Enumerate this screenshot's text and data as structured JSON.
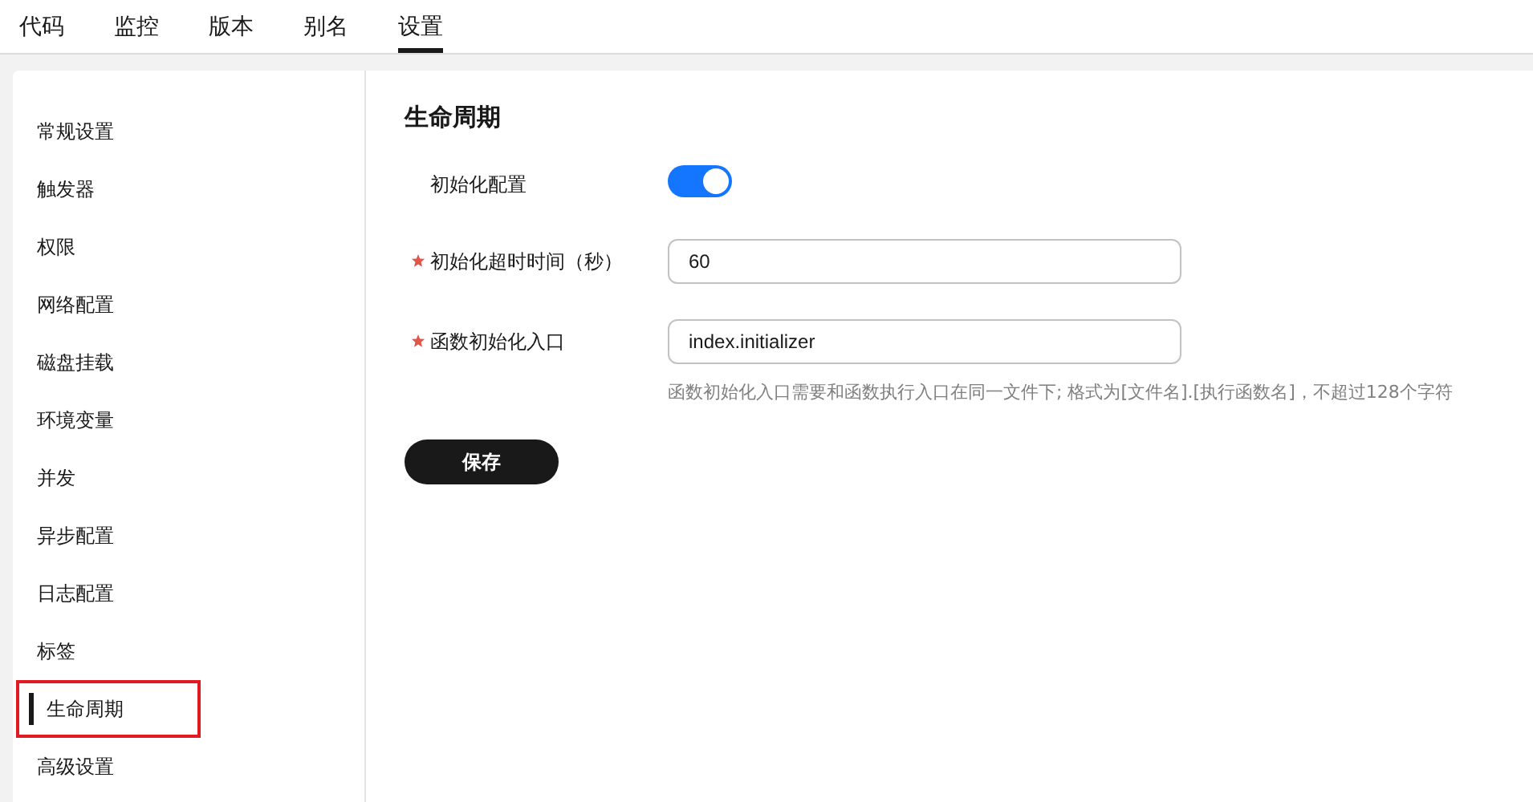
{
  "tabs": [
    {
      "label": "代码",
      "selected": false
    },
    {
      "label": "监控",
      "selected": false
    },
    {
      "label": "版本",
      "selected": false
    },
    {
      "label": "别名",
      "selected": false
    },
    {
      "label": "设置",
      "selected": true
    }
  ],
  "sidebar": {
    "items": [
      {
        "label": "常规设置",
        "selected": false,
        "highlighted": false
      },
      {
        "label": "触发器",
        "selected": false,
        "highlighted": false
      },
      {
        "label": "权限",
        "selected": false,
        "highlighted": false
      },
      {
        "label": "网络配置",
        "selected": false,
        "highlighted": false
      },
      {
        "label": "磁盘挂载",
        "selected": false,
        "highlighted": false
      },
      {
        "label": "环境变量",
        "selected": false,
        "highlighted": false
      },
      {
        "label": "并发",
        "selected": false,
        "highlighted": false
      },
      {
        "label": "异步配置",
        "selected": false,
        "highlighted": false
      },
      {
        "label": "日志配置",
        "selected": false,
        "highlighted": false
      },
      {
        "label": "标签",
        "selected": false,
        "highlighted": false
      },
      {
        "label": "生命周期",
        "selected": true,
        "highlighted": true
      },
      {
        "label": "高级设置",
        "selected": false,
        "highlighted": false
      }
    ]
  },
  "section": {
    "title": "生命周期",
    "fields": [
      {
        "kind": "switch",
        "label": "初始化配置",
        "required": false,
        "on": true
      },
      {
        "kind": "input",
        "label": "初始化超时时间（秒）",
        "required": true,
        "value": "60"
      },
      {
        "kind": "input",
        "label": "函数初始化入口",
        "required": true,
        "value": "index.initializer",
        "hint": "函数初始化入口需要和函数执行入口在同一文件下; 格式为[文件名].[执行函数名]，不超过128个字符"
      }
    ],
    "save_button": "保存"
  }
}
